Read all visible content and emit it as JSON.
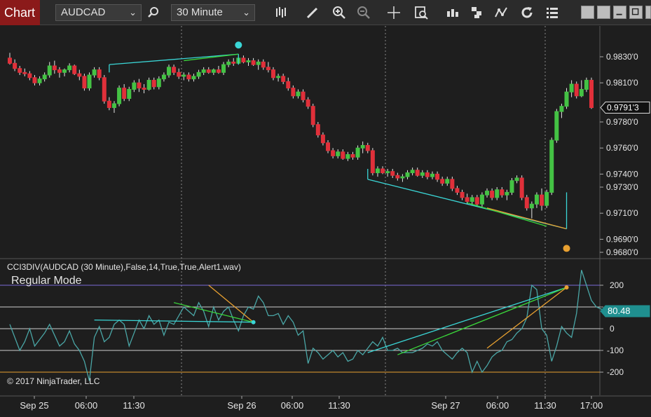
{
  "toolbar": {
    "tab_label": "Chart",
    "instrument": "AUDCAD",
    "interval": "30 Minute",
    "icons": [
      "search-icon",
      "bars-icon",
      "pencil-icon",
      "zoom-in-icon",
      "zoom-out-icon",
      "crosshair-icon",
      "data-box-icon",
      "properties-icon",
      "strategies-icon",
      "drawing-tools-icon",
      "refresh-icon",
      "list-icon"
    ],
    "window_controls": [
      "tile-icon",
      "tile-icon",
      "minimize-icon",
      "maximize-icon",
      "close-icon"
    ]
  },
  "colors": {
    "up": "#44c244",
    "down": "#e0303a",
    "cci_line": "#4aa6a6",
    "cyan": "#3ad6d6",
    "green": "#3ad63a",
    "orange": "#e8a030",
    "purple_level": "#7a6ad6",
    "background": "#1e1e1e"
  },
  "price_panel": {
    "last_price": "0.9791'3",
    "y_ticks": [
      "0.9830'0",
      "0.9810'0",
      "0.9780'0",
      "0.9760'0",
      "0.9740'0",
      "0.9730'0",
      "0.9710'0",
      "0.9690'0",
      "0.9680'0"
    ]
  },
  "indicator_panel": {
    "title": "CCI3DIV(AUDCAD (30 Minute),False,14,True,True,Alert1.wav)",
    "mode": "Regular Mode",
    "current_value": "80.48",
    "y_ticks": [
      "200",
      "100",
      "0",
      "-100",
      "-200"
    ],
    "copyright": "© 2017 NinjaTrader, LLC"
  },
  "x_axis": {
    "ticks": [
      "Sep 25",
      "06:00",
      "11:30",
      "Sep 26",
      "06:00",
      "11:30",
      "Sep 27",
      "06:00",
      "11:30",
      "17:00"
    ]
  },
  "chart_data": [
    {
      "type": "candlestick",
      "title": "AUDCAD (30 Minute)",
      "ylabel": "",
      "ylim": [
        0.9675,
        0.9845
      ],
      "candles": [
        [
          0.9829,
          0.9833,
          0.9824,
          0.9825
        ],
        [
          0.9825,
          0.9828,
          0.9819,
          0.9821
        ],
        [
          0.9821,
          0.9823,
          0.9816,
          0.9818
        ],
        [
          0.9818,
          0.9821,
          0.9815,
          0.9817
        ],
        [
          0.9817,
          0.9819,
          0.9812,
          0.9814
        ],
        [
          0.9814,
          0.9816,
          0.9808,
          0.981
        ],
        [
          0.981,
          0.9815,
          0.9808,
          0.9813
        ],
        [
          0.9813,
          0.9818,
          0.9811,
          0.9816
        ],
        [
          0.9816,
          0.9826,
          0.9814,
          0.9823
        ],
        [
          0.9823,
          0.9827,
          0.9817,
          0.982
        ],
        [
          0.982,
          0.9822,
          0.9814,
          0.9818
        ],
        [
          0.9818,
          0.9821,
          0.9815,
          0.982
        ],
        [
          0.982,
          0.9825,
          0.9818,
          0.9823
        ],
        [
          0.9823,
          0.9824,
          0.9816,
          0.9817
        ],
        [
          0.9817,
          0.982,
          0.9812,
          0.9815
        ],
        [
          0.9815,
          0.9817,
          0.9804,
          0.9806
        ],
        [
          0.9806,
          0.9818,
          0.9804,
          0.9816
        ],
        [
          0.9816,
          0.9822,
          0.9814,
          0.982
        ],
        [
          0.982,
          0.9822,
          0.9812,
          0.9814
        ],
        [
          0.9814,
          0.9816,
          0.9794,
          0.9796
        ],
        [
          0.9796,
          0.9799,
          0.9789,
          0.9791
        ],
        [
          0.9791,
          0.9796,
          0.9787,
          0.9794
        ],
        [
          0.9794,
          0.9808,
          0.9792,
          0.9806
        ],
        [
          0.9806,
          0.9809,
          0.9796,
          0.9798
        ],
        [
          0.9798,
          0.9807,
          0.9796,
          0.9805
        ],
        [
          0.9805,
          0.9812,
          0.9803,
          0.981
        ],
        [
          0.981,
          0.9813,
          0.9803,
          0.9806
        ],
        [
          0.9806,
          0.9809,
          0.9802,
          0.9805
        ],
        [
          0.9805,
          0.9814,
          0.9804,
          0.9812
        ],
        [
          0.9812,
          0.9814,
          0.9805,
          0.9807
        ],
        [
          0.9807,
          0.9815,
          0.9805,
          0.9813
        ],
        [
          0.9813,
          0.9818,
          0.9811,
          0.9816
        ],
        [
          0.9816,
          0.9824,
          0.9814,
          0.9822
        ],
        [
          0.9822,
          0.9824,
          0.9816,
          0.9818
        ],
        [
          0.9818,
          0.9821,
          0.9813,
          0.9815
        ],
        [
          0.9815,
          0.9818,
          0.9812,
          0.9816
        ],
        [
          0.9816,
          0.9818,
          0.9811,
          0.9813
        ],
        [
          0.9813,
          0.9817,
          0.9811,
          0.9815
        ],
        [
          0.9815,
          0.982,
          0.9813,
          0.9818
        ],
        [
          0.9818,
          0.9822,
          0.9816,
          0.982
        ],
        [
          0.982,
          0.9822,
          0.9817,
          0.9818
        ],
        [
          0.9818,
          0.9821,
          0.9816,
          0.982
        ],
        [
          0.982,
          0.9823,
          0.9817,
          0.9818
        ],
        [
          0.9818,
          0.9826,
          0.9816,
          0.9824
        ],
        [
          0.9824,
          0.9828,
          0.9822,
          0.9826
        ],
        [
          0.9826,
          0.9829,
          0.9823,
          0.9825
        ],
        [
          0.9825,
          0.9831,
          0.9824,
          0.9829
        ],
        [
          0.9829,
          0.9831,
          0.9825,
          0.9826
        ],
        [
          0.9826,
          0.9829,
          0.9823,
          0.9827
        ],
        [
          0.9827,
          0.9829,
          0.9823,
          0.9824
        ],
        [
          0.9824,
          0.9828,
          0.982,
          0.9826
        ],
        [
          0.9826,
          0.9828,
          0.982,
          0.9822
        ],
        [
          0.9822,
          0.9826,
          0.9818,
          0.982
        ],
        [
          0.982,
          0.9822,
          0.9812,
          0.9814
        ],
        [
          0.9814,
          0.9817,
          0.9811,
          0.9815
        ],
        [
          0.9815,
          0.9817,
          0.9809,
          0.9811
        ],
        [
          0.9811,
          0.9814,
          0.9804,
          0.9806
        ],
        [
          0.9806,
          0.9808,
          0.9798,
          0.98
        ],
        [
          0.98,
          0.9805,
          0.9798,
          0.9803
        ],
        [
          0.9803,
          0.9805,
          0.9795,
          0.9797
        ],
        [
          0.9797,
          0.9799,
          0.979,
          0.9792
        ],
        [
          0.9792,
          0.9794,
          0.9776,
          0.9778
        ],
        [
          0.9778,
          0.978,
          0.9768,
          0.977
        ],
        [
          0.977,
          0.9772,
          0.9762,
          0.9764
        ],
        [
          0.9764,
          0.9766,
          0.9756,
          0.9758
        ],
        [
          0.9758,
          0.976,
          0.9752,
          0.9754
        ],
        [
          0.9754,
          0.9759,
          0.9752,
          0.9757
        ],
        [
          0.9757,
          0.9759,
          0.9751,
          0.9752
        ],
        [
          0.9752,
          0.9757,
          0.975,
          0.9755
        ],
        [
          0.9755,
          0.9757,
          0.9751,
          0.9753
        ],
        [
          0.9753,
          0.9762,
          0.9751,
          0.976
        ],
        [
          0.976,
          0.9765,
          0.9756,
          0.9762
        ],
        [
          0.9762,
          0.9764,
          0.9756,
          0.9758
        ],
        [
          0.9758,
          0.976,
          0.9739,
          0.9741
        ],
        [
          0.9741,
          0.9746,
          0.9738,
          0.9744
        ],
        [
          0.9744,
          0.9746,
          0.974,
          0.9741
        ],
        [
          0.9741,
          0.9744,
          0.9738,
          0.9742
        ],
        [
          0.9742,
          0.9744,
          0.9737,
          0.9739
        ],
        [
          0.9739,
          0.9741,
          0.9735,
          0.9737
        ],
        [
          0.9737,
          0.974,
          0.9734,
          0.9738
        ],
        [
          0.9738,
          0.9743,
          0.9736,
          0.9741
        ],
        [
          0.9741,
          0.9745,
          0.9739,
          0.9743
        ],
        [
          0.9743,
          0.9745,
          0.9738,
          0.9739
        ],
        [
          0.9739,
          0.9743,
          0.9737,
          0.9741
        ],
        [
          0.9741,
          0.9743,
          0.9736,
          0.9738
        ],
        [
          0.9738,
          0.9742,
          0.9736,
          0.974
        ],
        [
          0.974,
          0.9742,
          0.9734,
          0.9736
        ],
        [
          0.9736,
          0.9738,
          0.9731,
          0.9733
        ],
        [
          0.9733,
          0.9738,
          0.9731,
          0.9736
        ],
        [
          0.9736,
          0.9738,
          0.9727,
          0.9729
        ],
        [
          0.9729,
          0.9731,
          0.9724,
          0.9726
        ],
        [
          0.9726,
          0.9728,
          0.972,
          0.9722
        ],
        [
          0.9722,
          0.9725,
          0.9717,
          0.9719
        ],
        [
          0.9719,
          0.9724,
          0.9716,
          0.9722
        ],
        [
          0.9722,
          0.9724,
          0.9715,
          0.9717
        ],
        [
          0.9717,
          0.9726,
          0.9715,
          0.9724
        ],
        [
          0.9724,
          0.9729,
          0.9722,
          0.9727
        ],
        [
          0.9727,
          0.9729,
          0.972,
          0.9722
        ],
        [
          0.9722,
          0.973,
          0.972,
          0.9728
        ],
        [
          0.9728,
          0.973,
          0.9722,
          0.9724
        ],
        [
          0.9724,
          0.9728,
          0.972,
          0.9726
        ],
        [
          0.9726,
          0.9737,
          0.9724,
          0.9735
        ],
        [
          0.9735,
          0.9739,
          0.9733,
          0.9737
        ],
        [
          0.9737,
          0.9739,
          0.972,
          0.9722
        ],
        [
          0.9722,
          0.9724,
          0.9712,
          0.9714
        ],
        [
          0.9714,
          0.9719,
          0.9706,
          0.9717
        ],
        [
          0.9717,
          0.9726,
          0.9714,
          0.9724
        ],
        [
          0.9724,
          0.9729,
          0.9712,
          0.9716
        ],
        [
          0.9716,
          0.9728,
          0.9714,
          0.9726
        ],
        [
          0.9726,
          0.9768,
          0.9724,
          0.9766
        ],
        [
          0.9766,
          0.979,
          0.9764,
          0.9788
        ],
        [
          0.9788,
          0.9794,
          0.9783,
          0.9792
        ],
        [
          0.9792,
          0.9806,
          0.979,
          0.9803
        ],
        [
          0.9803,
          0.9812,
          0.9799,
          0.9809
        ],
        [
          0.9809,
          0.9811,
          0.9798,
          0.98
        ],
        [
          0.98,
          0.9812,
          0.9799,
          0.9805
        ],
        [
          0.9805,
          0.9814,
          0.9803,
          0.9812
        ],
        [
          0.9812,
          0.9814,
          0.979,
          0.9791
        ]
      ],
      "divergence_lines": [
        {
          "color": "cyan",
          "from": [
            20,
            0.9824
          ],
          "to": [
            46,
            0.9832
          ]
        },
        {
          "color": "green",
          "from": [
            35,
            0.9827
          ],
          "to": [
            46,
            0.9832
          ]
        },
        {
          "color": "cyan",
          "from": [
            72,
            0.9736
          ],
          "to": [
            112,
            0.9698
          ]
        },
        {
          "color": "green",
          "from": [
            92,
            0.9718
          ],
          "to": [
            108,
            0.97
          ]
        },
        {
          "color": "orange",
          "from": [
            96,
            0.9714
          ],
          "to": [
            112,
            0.9698
          ]
        }
      ],
      "signal_dots": [
        {
          "color": "cyan",
          "x": 46,
          "y": 0.9839
        },
        {
          "color": "orange",
          "x": 112,
          "y": 0.9683
        }
      ]
    },
    {
      "type": "line",
      "title": "CCI3DIV",
      "ylabel": "",
      "ylim": [
        -260,
        280
      ],
      "levels": [
        {
          "value": 200,
          "color": "purple_level"
        },
        {
          "value": 100,
          "color": "white"
        },
        {
          "value": 0,
          "color": "white"
        },
        {
          "value": -100,
          "color": "white"
        },
        {
          "value": -200,
          "color": "orange"
        }
      ],
      "series": [
        {
          "values": [
            20,
            -40,
            -100,
            -60,
            0,
            -80,
            -50,
            -20,
            20,
            -30,
            -80,
            -60,
            -10,
            -70,
            -100,
            -150,
            -240,
            -40,
            10,
            -60,
            -40,
            20,
            40,
            20,
            -80,
            -20,
            40,
            0,
            60,
            20,
            40,
            -30,
            30,
            20,
            60,
            100,
            80,
            60,
            120,
            80,
            10,
            100,
            40,
            80,
            100,
            40,
            -10,
            60,
            100,
            90,
            150,
            120,
            60,
            60,
            70,
            20,
            60,
            30,
            -30,
            -10,
            -160,
            -90,
            -110,
            -140,
            -120,
            -100,
            -130,
            -110,
            -150,
            -140,
            -100,
            -120,
            -90,
            -60,
            -80,
            -40,
            -100,
            -100,
            -90,
            -110,
            -110,
            -110,
            -100,
            -90,
            -70,
            -80,
            -60,
            -100,
            -120,
            -140,
            -110,
            -90,
            -110,
            -200,
            -150,
            -200,
            -170,
            -130,
            -110,
            -100,
            -60,
            -50,
            -20,
            0,
            50,
            200,
            180,
            0,
            -30,
            -150,
            -80,
            10,
            -20,
            -40,
            70,
            270,
            200,
            130,
            100,
            90,
            80
          ]
        }
      ],
      "divergence_lines": [
        {
          "color": "cyan",
          "from": [
            17,
            40
          ],
          "to": [
            49,
            30
          ]
        },
        {
          "color": "green",
          "from": [
            33,
            120
          ],
          "to": [
            49,
            30
          ]
        },
        {
          "color": "orange",
          "from": [
            40,
            200
          ],
          "to": [
            49,
            30
          ]
        },
        {
          "color": "cyan",
          "from": [
            72,
            -110
          ],
          "to": [
            112,
            190
          ]
        },
        {
          "color": "green",
          "from": [
            78,
            -120
          ],
          "to": [
            112,
            190
          ]
        },
        {
          "color": "orange",
          "from": [
            96,
            -90
          ],
          "to": [
            112,
            190
          ]
        }
      ],
      "signal_dots": [
        {
          "color": "cyan",
          "x": 49,
          "y": 30
        },
        {
          "color": "orange",
          "x": 112,
          "y": 190
        }
      ]
    }
  ]
}
